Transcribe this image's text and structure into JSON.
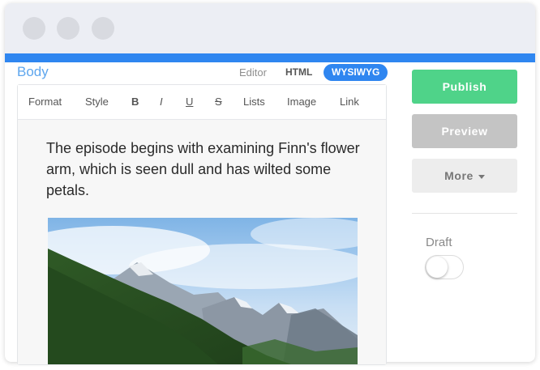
{
  "editor": {
    "body_label": "Body",
    "modes": {
      "editor": "Editor",
      "html": "HTML",
      "wysiwyg": "WYSIWYG",
      "active": "WYSIWYG"
    },
    "toolbar": {
      "format": "Format",
      "style": "Style",
      "bold": "B",
      "italic": "I",
      "underline": "U",
      "strike": "S",
      "lists": "Lists",
      "image": "Image",
      "link": "Link"
    },
    "content": {
      "paragraph": "The episode begins with examining Finn's flower arm, which is seen dull and has wilted some petals."
    }
  },
  "sidebar": {
    "publish_label": "Publish",
    "preview_label": "Preview",
    "more_label": "More",
    "draft_label": "Draft",
    "draft_enabled": false
  },
  "colors": {
    "accent": "#2f86f0",
    "publish": "#4fd389",
    "preview": "#c4c4c4",
    "titlebar": "#eceef4"
  }
}
